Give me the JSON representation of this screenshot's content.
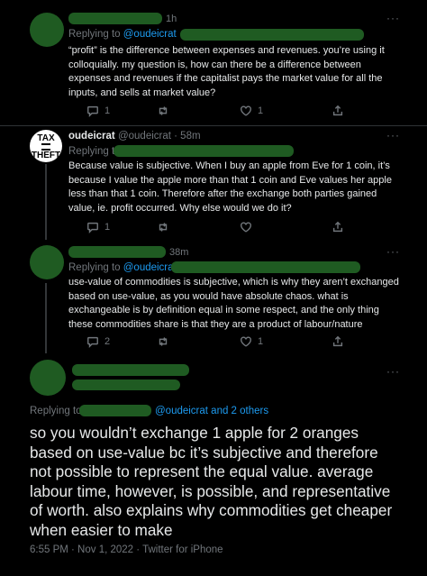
{
  "tweet1": {
    "time": "1h",
    "replying_prefix": "Replying to",
    "replying_handle": "@oudeicrat",
    "text": "“profit” is the difference between expenses and revenues. you’re using it colloquially. my question is, how can there be a difference between expenses and revenues if the capitalist pays the market value for all the inputs, and sells at market value?",
    "reply_count": "1",
    "retweet_count": "",
    "like_count": "1"
  },
  "tweet2": {
    "name": "oudeicrat",
    "handle": "@oudeicrat",
    "time": "· 58m",
    "replying_prefix": "Replying to",
    "avatar_text_top": "TAX",
    "avatar_text_bottom": "THEFT",
    "text": "Because value is subjective. When I buy an apple from Eve for 1 coin, it’s because I value the apple more than that 1 coin and Eve values her apple less than that 1 coin. Therefore after the exchange both parties gained value, ie. profit occurred. Why else would we do it?",
    "reply_count": "1",
    "retweet_count": "",
    "like_count": ""
  },
  "tweet3": {
    "time": "38m",
    "replying_prefix": "Replying to",
    "replying_handle": "@oudeicrat",
    "text": "use-value of commodities is subjective, which is why they aren’t exchanged based on use-value, as you would have absolute chaos. what is exchangeable is by definition equal in some respect, and the only thing these commodities share is that they are a product of labour/nature",
    "reply_count": "2",
    "retweet_count": "",
    "like_count": "1"
  },
  "main": {
    "replying_prefix": "Replying to",
    "replying_handles": "@oudeicrat and 2 others",
    "text": "so you wouldn’t exchange 1 apple for 2 oranges based on use-value bc it’s subjective and therefore not possible to represent the equal value. average labour time, however, is possible, and representative of worth. also explains why commodities get cheaper when easier to make",
    "timestamp": "6:55 PM · Nov 1, 2022 · Twitter for iPhone"
  },
  "more_icon": "···",
  "colors": {
    "background": "#000000",
    "text": "#e7e9ea",
    "muted": "#71767b",
    "link": "#1d9bf0",
    "redaction": "#1f5b22"
  }
}
